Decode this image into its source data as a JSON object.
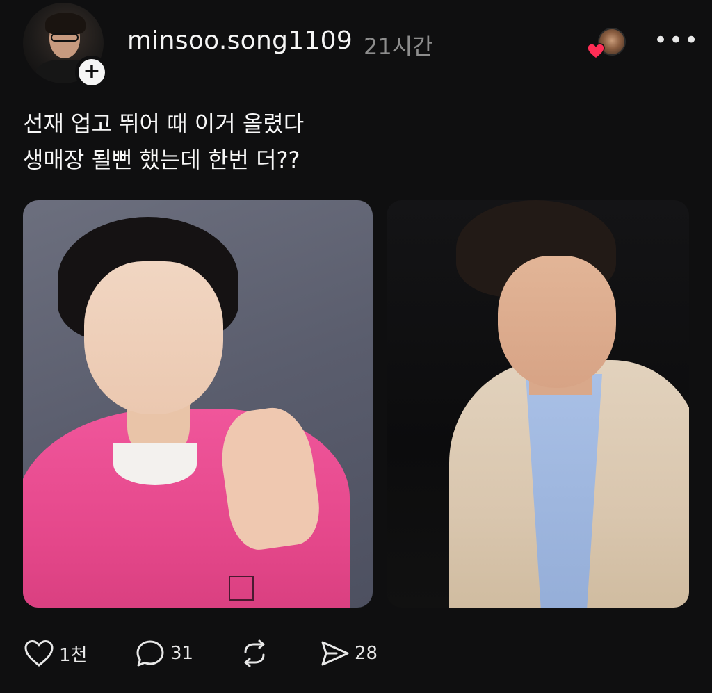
{
  "post": {
    "username": "minsoo.song1109",
    "time": "21시간",
    "more_label": "•••",
    "caption_lines": [
      "선재 업고 뛰어 때 이거 올렸다",
      "생매장 될뻔 했는데 한번 더??"
    ],
    "follow_badge": "+",
    "icons": {
      "avatar": "profile-avatar",
      "follow": "plus-icon",
      "liked_by": "liked-by-avatar",
      "liked_heart": "heart-icon",
      "more": "more-icon"
    },
    "images": [
      {
        "name": "photo-left",
        "description_icon": "photo"
      },
      {
        "name": "photo-right",
        "description_icon": "photo"
      }
    ]
  },
  "actions": {
    "like": {
      "icon": "heart-outline-icon",
      "count": "1천"
    },
    "comment": {
      "icon": "comment-icon",
      "count": "31"
    },
    "repost": {
      "icon": "repost-icon",
      "count": ""
    },
    "share": {
      "icon": "send-icon",
      "count": "28"
    }
  },
  "colors": {
    "background": "#0f0f10",
    "text_primary": "#f5f5f5",
    "text_secondary": "#8d8d8d",
    "heart_red": "#ff2d55"
  }
}
